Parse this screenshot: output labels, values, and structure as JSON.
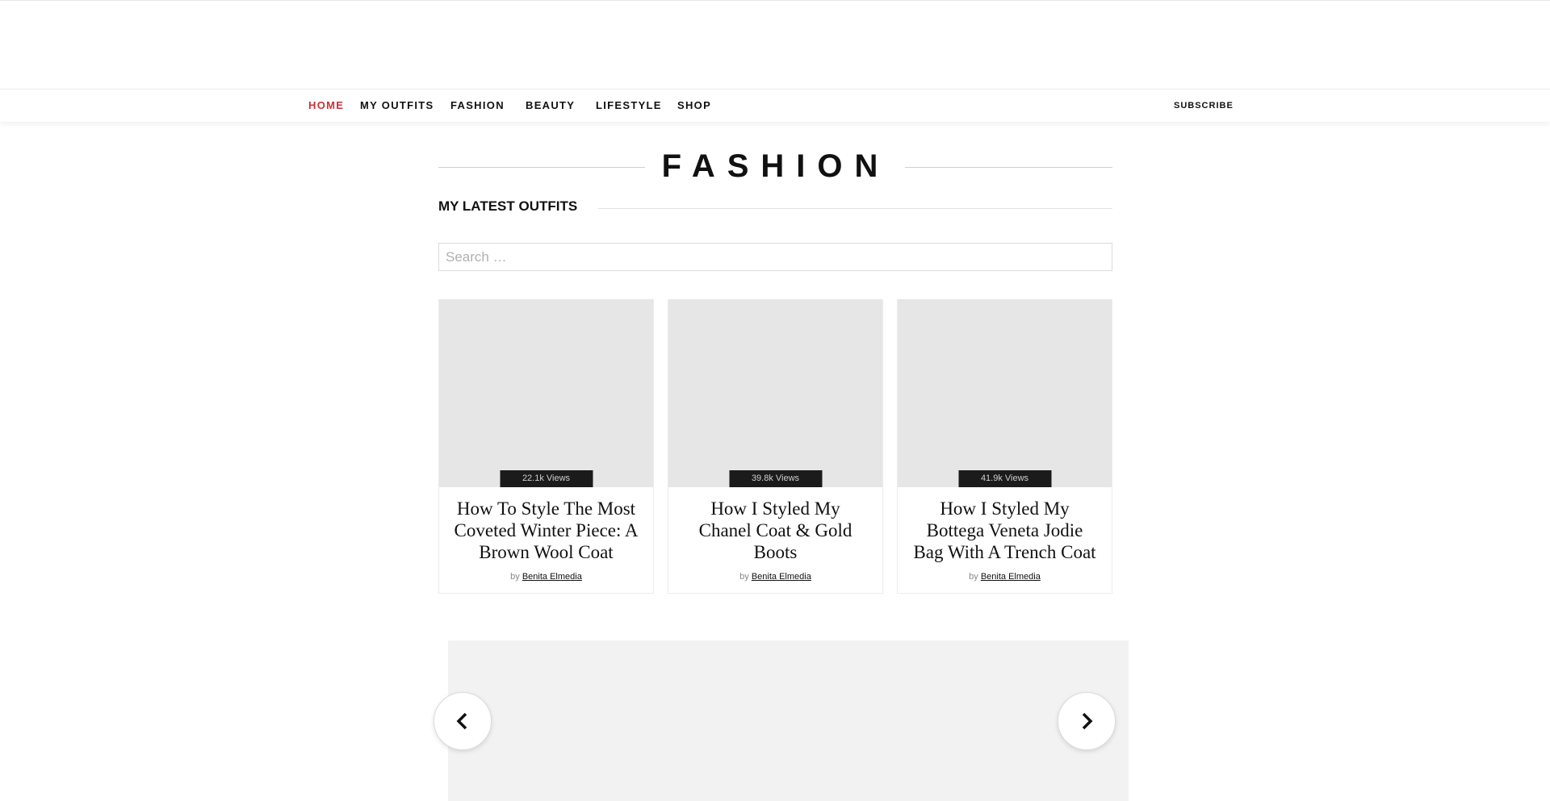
{
  "nav": {
    "items": [
      {
        "label": "HOME",
        "active": true
      },
      {
        "label": "MY OUTFITS",
        "active": false
      },
      {
        "label": "FASHION",
        "active": false
      },
      {
        "label": "BEAUTY",
        "active": false
      },
      {
        "label": "LIFESTYLE",
        "active": false
      },
      {
        "label": "SHOP",
        "active": false
      }
    ],
    "subscribe_label": "SUBSCRIBE",
    "active_color": "#c8313a"
  },
  "page": {
    "title": "FASHION",
    "section_title": "MY LATEST OUTFITS"
  },
  "search": {
    "placeholder": "Search …",
    "value": ""
  },
  "posts": [
    {
      "views": "22.1k Views",
      "title": "How To Style The Most Coveted Winter Piece: A Brown Wool Coat",
      "by": "by",
      "author": "Benita Elmedia"
    },
    {
      "views": "39.8k Views",
      "title": "How I Styled My Chanel Coat & Gold Boots",
      "by": "by",
      "author": "Benita Elmedia"
    },
    {
      "views": "41.9k Views",
      "title": "How I Styled My Bottega Veneta Jodie Bag With A Trench Coat",
      "by": "by",
      "author": "Benita Elmedia"
    }
  ],
  "slider": {
    "prev_icon": "chevron-left-icon",
    "next_icon": "chevron-right-icon"
  }
}
